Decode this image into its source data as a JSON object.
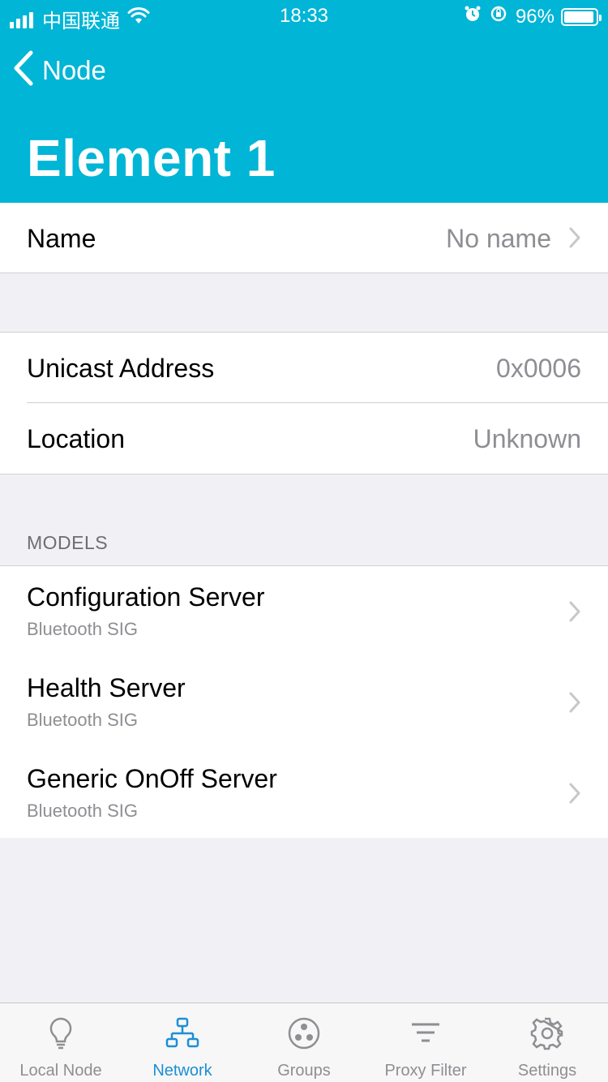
{
  "status_bar": {
    "carrier": "中国联通",
    "time": "18:33",
    "battery": "96%",
    "battery_level": 0.96
  },
  "nav": {
    "back_label": "Node",
    "title": "Element 1"
  },
  "name_row": {
    "label": "Name",
    "value": "No name"
  },
  "info_rows": [
    {
      "label": "Unicast Address",
      "value": "0x0006"
    },
    {
      "label": "Location",
      "value": "Unknown"
    }
  ],
  "models_header": "MODELS",
  "models": [
    {
      "title": "Configuration Server",
      "subtitle": "Bluetooth SIG"
    },
    {
      "title": "Health Server",
      "subtitle": "Bluetooth SIG"
    },
    {
      "title": "Generic OnOff Server",
      "subtitle": "Bluetooth SIG"
    }
  ],
  "tabs": [
    {
      "label": "Local Node",
      "icon": "lightbulb-icon"
    },
    {
      "label": "Network",
      "icon": "network-icon",
      "active": true
    },
    {
      "label": "Groups",
      "icon": "groups-icon"
    },
    {
      "label": "Proxy Filter",
      "icon": "filter-icon"
    },
    {
      "label": "Settings",
      "icon": "gear-icon"
    }
  ],
  "colors": {
    "header": "#00b5d6",
    "active_tab": "#1c8fd4",
    "inactive_tab": "#8e8e93",
    "background": "#f0f0f5"
  }
}
